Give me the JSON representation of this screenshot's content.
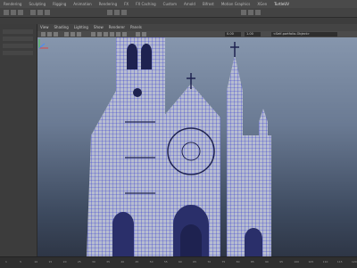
{
  "menu": {
    "items": [
      "Rendering",
      "Sculpting",
      "Rigging",
      "Animation",
      "Rendering",
      "FX",
      "FX Caching",
      "Custom",
      "Arnold",
      "Bifrost",
      "Motion Graphics",
      "XGen",
      "TurtleUV"
    ]
  },
  "panel": {
    "menus": [
      "View",
      "Shading",
      "Lighting",
      "Show",
      "Renderer",
      "Panels"
    ]
  },
  "viewport_toolbar": {
    "value": "0.00",
    "value2": "1.00",
    "camera_field": "<Self-portfolio-Object>"
  },
  "timeline": {
    "ticks": [
      "1",
      "5",
      "10",
      "15",
      "20",
      "25",
      "30",
      "35",
      "40",
      "45",
      "50",
      "55",
      "60",
      "65",
      "70",
      "75",
      "80",
      "85",
      "90",
      "95",
      "100",
      "105",
      "110",
      "115",
      "120"
    ]
  },
  "colors": {
    "wire": "#2b2fd0",
    "mesh_fill": "#b7bdd0",
    "viewport_top": "#8696ad",
    "viewport_bottom": "#2e3646"
  }
}
